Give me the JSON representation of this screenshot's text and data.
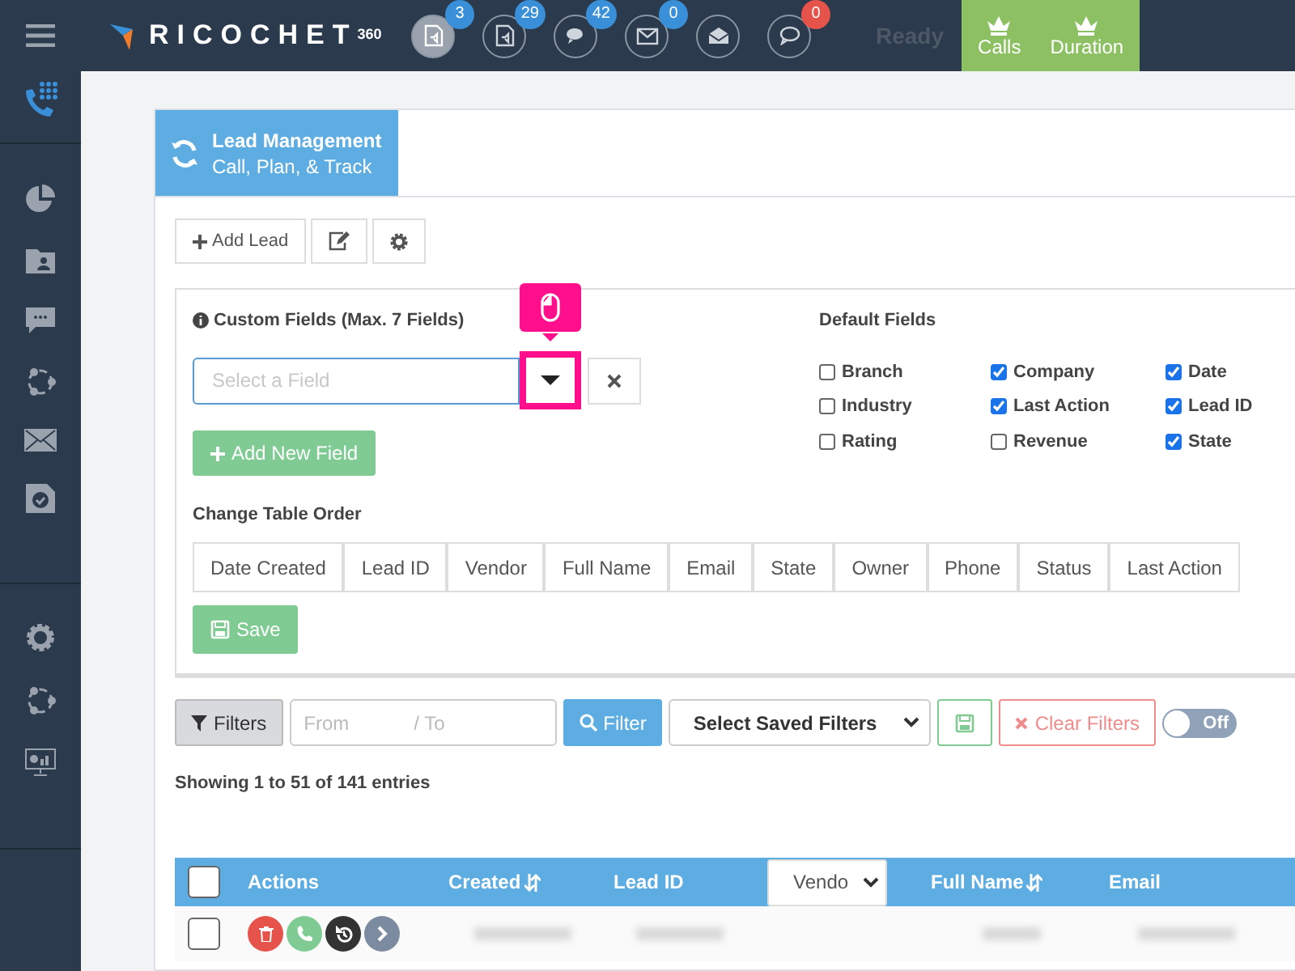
{
  "topbar": {
    "logo_text": "RICOCHET",
    "logo_sup": "360",
    "icons": [
      {
        "badge": "3",
        "color": "#3a8fd9",
        "selected": true
      },
      {
        "badge": "29",
        "color": "#3a8fd9",
        "selected": false
      },
      {
        "badge": "42",
        "color": "#3a8fd9",
        "selected": false
      },
      {
        "badge": "0",
        "color": "#3a8fd9",
        "selected": false
      },
      {
        "selected": false
      },
      {
        "badge": "0",
        "color": "#e5534b",
        "selected": false
      }
    ],
    "status": "Ready",
    "stats": [
      {
        "label": "Calls"
      },
      {
        "label": "Duration"
      }
    ]
  },
  "page_header": {
    "title": "Lead Management",
    "subtitle": "Call, Plan, & Track"
  },
  "toolbar": {
    "add_lead": "Add Lead"
  },
  "custom_fields": {
    "label": "Custom Fields (Max. 7 Fields)",
    "placeholder": "Select a Field",
    "dropdown_highlighted": true,
    "add_button": "Add New Field"
  },
  "default_fields": {
    "title": "Default Fields",
    "fields": [
      {
        "label": "Branch",
        "checked": false
      },
      {
        "label": "Industry",
        "checked": false
      },
      {
        "label": "Rating",
        "checked": false
      },
      {
        "label": "Company",
        "checked": true
      },
      {
        "label": "Last Action",
        "checked": true
      },
      {
        "label": "Revenue",
        "checked": false
      },
      {
        "label": "Date",
        "checked": true
      },
      {
        "label": "Lead ID",
        "checked": true
      },
      {
        "label": "State",
        "checked": true
      }
    ]
  },
  "table_order": {
    "title": "Change Table Order",
    "columns": [
      "Date Created",
      "Lead ID",
      "Vendor",
      "Full Name",
      "Email",
      "State",
      "Owner",
      "Phone",
      "Status",
      "Last Action"
    ],
    "save_button": "Save"
  },
  "filters": {
    "filters_button": "Filters",
    "from_placeholder": "From",
    "to_placeholder": "/ To",
    "filter_button": "Filter",
    "saved_filters": "Select Saved Filters",
    "clear_button": "Clear Filters",
    "toggle": {
      "label": "Off",
      "on": false
    }
  },
  "entries": "Showing 1 to 51 of 141 entries",
  "table": {
    "select_all_checked": false,
    "columns": [
      {
        "label": "Actions",
        "kind": "text",
        "sortable": false
      },
      {
        "label": "Created",
        "kind": "text",
        "sortable": true
      },
      {
        "label": "Lead ID",
        "kind": "text",
        "sortable": false
      },
      {
        "label": "Vendo",
        "kind": "select",
        "sortable": false
      },
      {
        "label": "Full Name",
        "kind": "text",
        "sortable": true
      },
      {
        "label": "Email",
        "kind": "text",
        "sortable": false
      }
    ],
    "rows": [
      {
        "checked": false
      }
    ]
  }
}
